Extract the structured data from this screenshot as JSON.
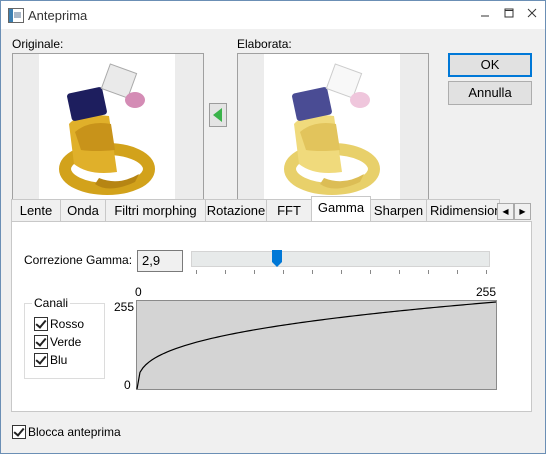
{
  "window": {
    "title": "Anteprima",
    "minimize_icon": "minimize-icon",
    "maximize_icon": "maximize-icon",
    "close_icon": "close-icon"
  },
  "labels": {
    "original": "Originale:",
    "processed": "Elaborata:"
  },
  "buttons": {
    "ok": "OK",
    "cancel": "Annulla"
  },
  "tabs": [
    "Lente",
    "Onda",
    "Filtri morphing",
    "Rotazione",
    "FFT",
    "Gamma",
    "Sharpen",
    "Ridimensiona"
  ],
  "active_tab": "Gamma",
  "gamma": {
    "label": "Correzione Gamma:",
    "value": "2,9",
    "slider_fraction": 0.29
  },
  "channels": {
    "legend": "Canali",
    "items": [
      {
        "label": "Rosso",
        "checked": true
      },
      {
        "label": "Verde",
        "checked": true
      },
      {
        "label": "Blu",
        "checked": true
      }
    ]
  },
  "curve": {
    "x_min_label": "0",
    "x_max_label": "255",
    "y_max_label": "255",
    "y_min_label": "0",
    "gamma": 2.9
  },
  "lock_preview": {
    "label": "Blocca anteprima",
    "checked": true
  },
  "colors": {
    "accent": "#0078d7",
    "arrow": "#3ab34a",
    "curve_bg": "#d4d4d4"
  }
}
